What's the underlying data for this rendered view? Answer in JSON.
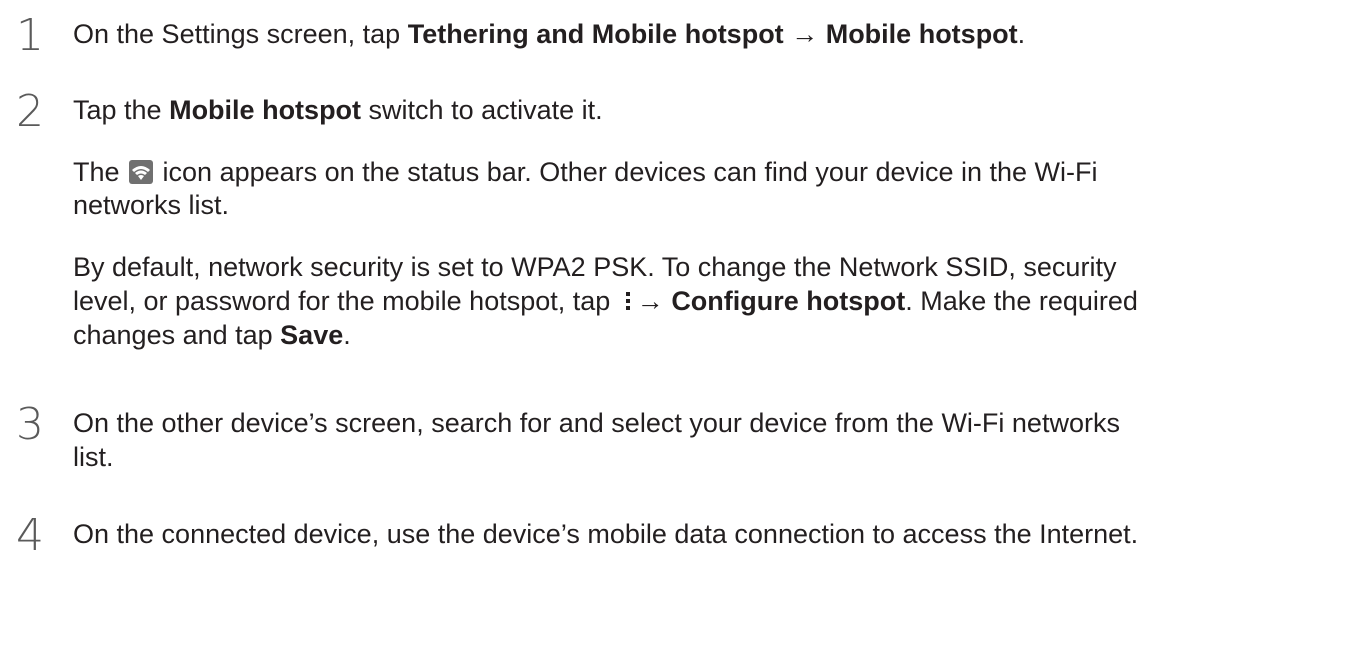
{
  "steps": [
    {
      "number": "1",
      "t1": "On the Settings screen, tap ",
      "b1": "Tethering and Mobile hotspot",
      "arrow": " → ",
      "b2": "Mobile hotspot",
      "t2": "."
    },
    {
      "number": "2",
      "t1": "Tap the ",
      "b1": "Mobile hotspot",
      "t2": " switch to activate it.",
      "p2a": "The ",
      "p2_icon": "wifi-hotspot-icon",
      "p2b": " icon appears on the status bar. Other devices can find your device in the Wi-Fi",
      "p2c": "networks list.",
      "p3a": "By default, network security is set to WPA2 PSK. To change the Network SSID, security",
      "p3b": "level,  or password for the mobile hotspot, tap ",
      "p3_icon": "more-options-icon",
      "p3c": "→ ",
      "p3_bold1": "Configure hotspot",
      "p3d": ". Make the required",
      "p3e": "changes and tap ",
      "p3_bold2": "Save",
      "p3f": "."
    },
    {
      "number": "3",
      "l1": "On the other device’s screen, search for and select your device from the Wi-Fi networks",
      "l2": "list."
    },
    {
      "number": "4",
      "l1": "On the connected device, use the device’s mobile data connection to access the Internet."
    }
  ],
  "colors": {
    "text": "#231f20",
    "step_number": "#5a5a5a",
    "icon_bg": "#707070"
  }
}
